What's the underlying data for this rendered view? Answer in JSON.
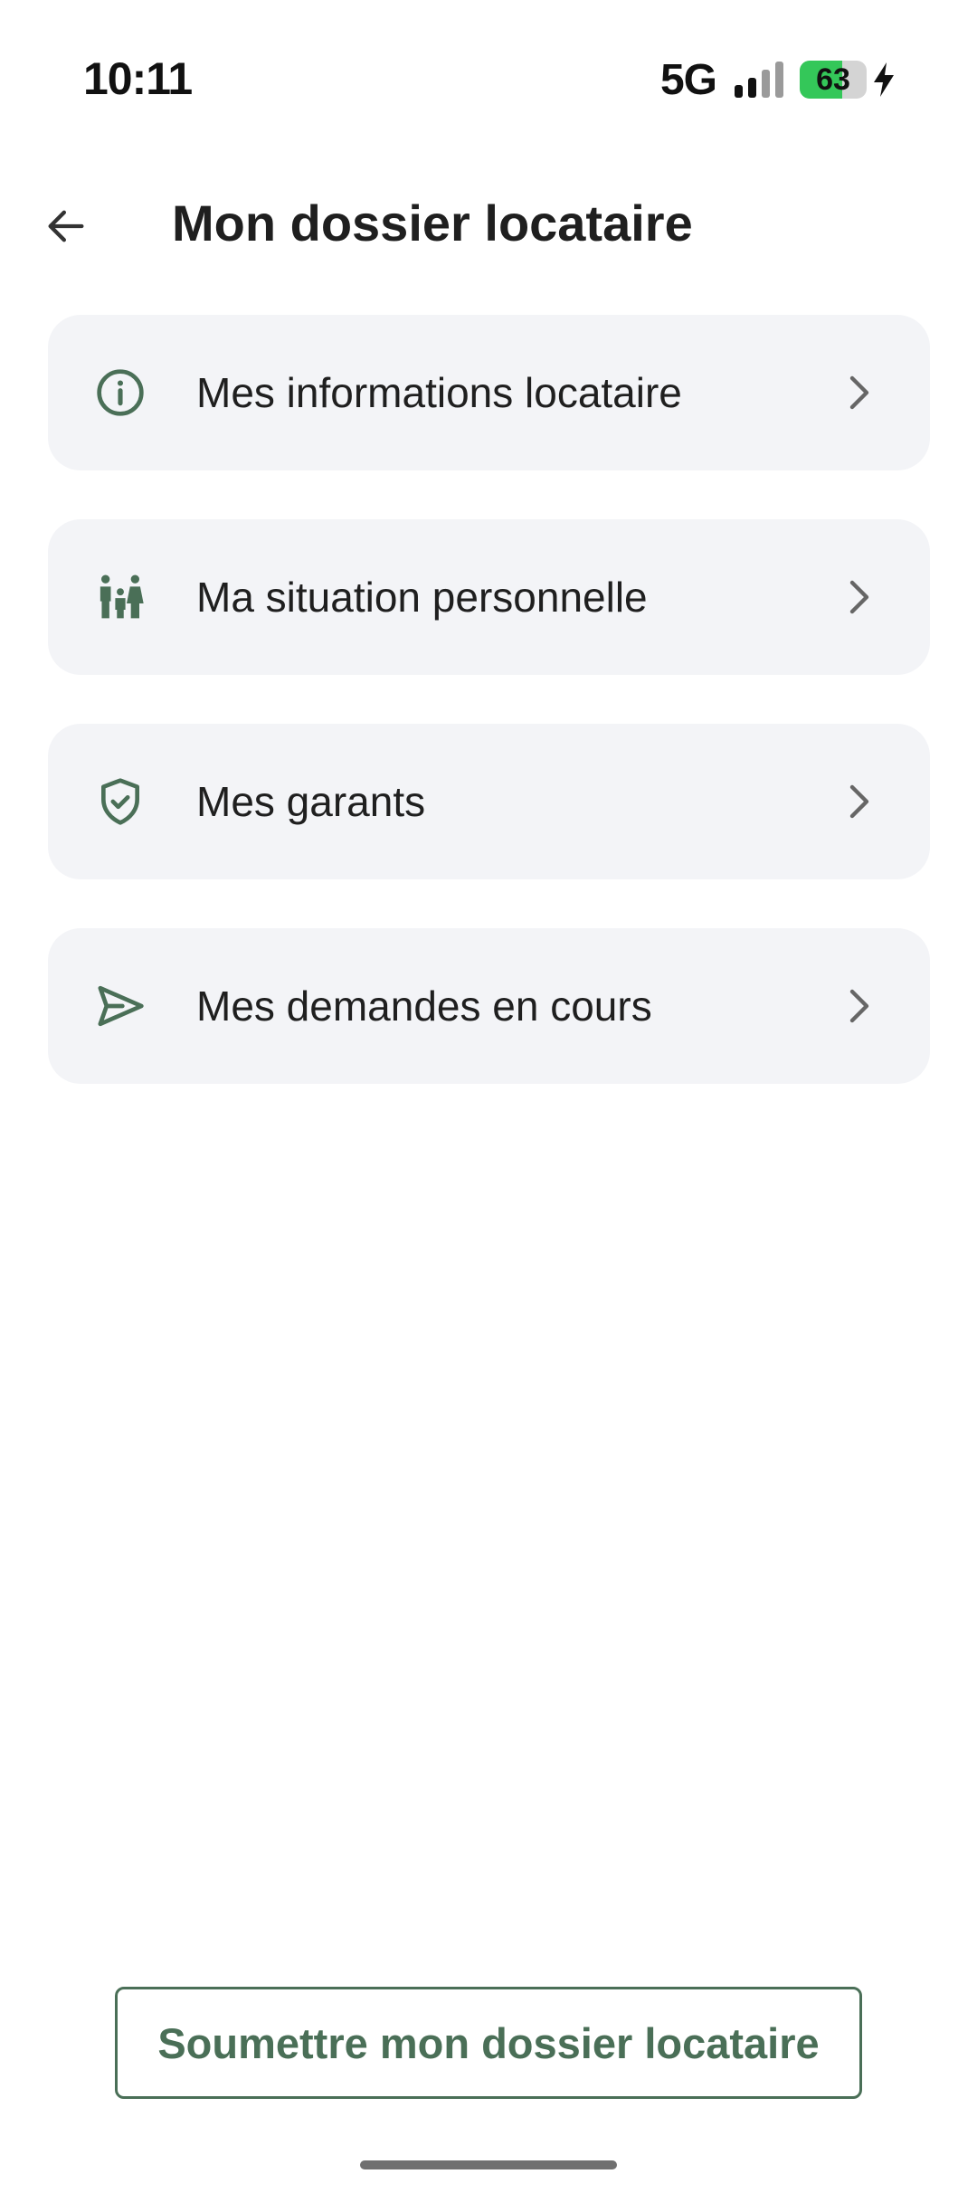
{
  "status_bar": {
    "time": "10:11",
    "network": "5G",
    "battery_percent": "63",
    "battery_level": 0.63,
    "icons": [
      "signal-icon",
      "battery-icon",
      "charging-bolt-icon"
    ]
  },
  "header": {
    "back_icon": "arrow-left-icon",
    "title": "Mon dossier locataire"
  },
  "menu": {
    "items": [
      {
        "label": "Mes informations locataire",
        "icon": "info-icon"
      },
      {
        "label": "Ma situation personnelle",
        "icon": "family-icon"
      },
      {
        "label": "Mes garants",
        "icon": "shield-check-icon"
      },
      {
        "label": "Mes demandes en cours",
        "icon": "send-icon"
      }
    ],
    "chevron_icon": "chevron-right-icon"
  },
  "footer": {
    "submit_label": "Soumettre mon dossier locataire"
  },
  "colors": {
    "accent": "#4a6f57",
    "card_background": "#f3f4f7",
    "battery_green": "#34c759",
    "text": "#1f1f1f"
  }
}
